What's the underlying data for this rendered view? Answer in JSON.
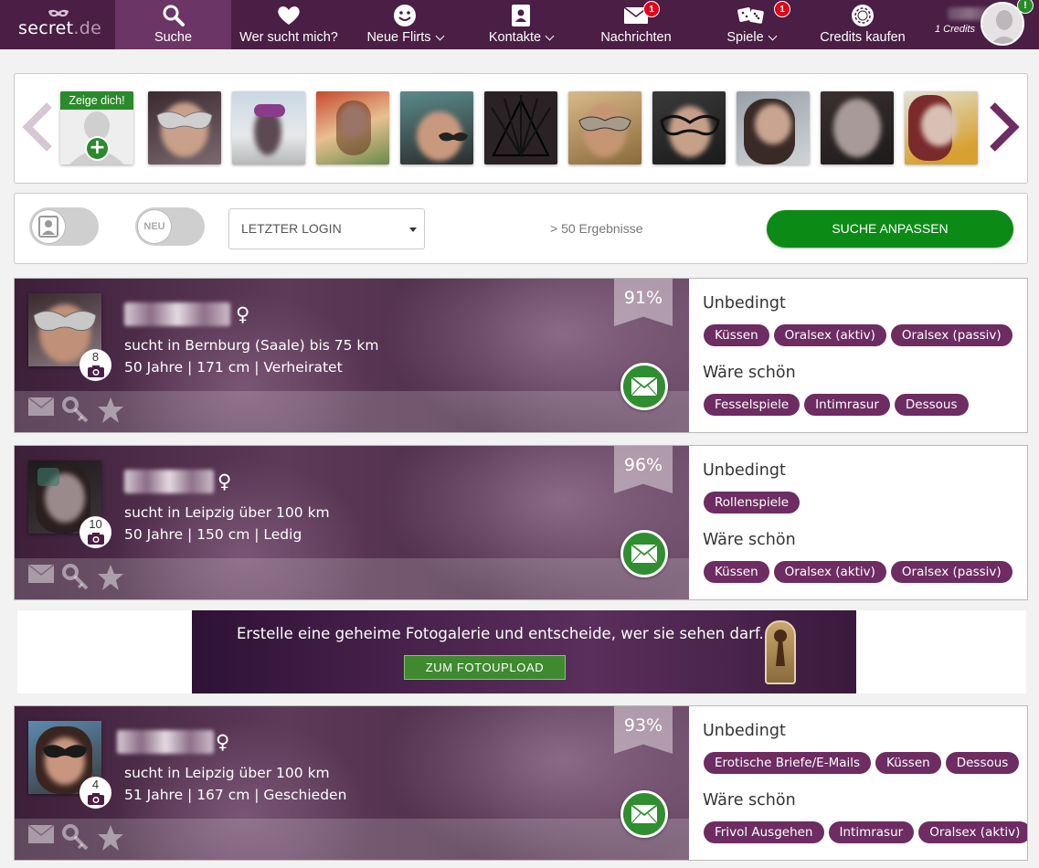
{
  "brand": {
    "name": "secret",
    "tld": ".de"
  },
  "nav": [
    {
      "label": "Suche",
      "icon": "search-icon",
      "active": true,
      "caret": false
    },
    {
      "label": "Wer sucht mich?",
      "icon": "heart-icon",
      "caret": false
    },
    {
      "label": "Neue Flirts",
      "icon": "smiley-icon",
      "caret": true
    },
    {
      "label": "Kontakte",
      "icon": "address-book-icon",
      "caret": true
    },
    {
      "label": "Nachrichten",
      "icon": "envelope-icon",
      "badge": "1",
      "caret": false
    },
    {
      "label": "Spiele",
      "icon": "dice-icon",
      "badge": "1",
      "caret": true
    },
    {
      "label": "Credits kaufen",
      "icon": "chip-icon",
      "caret": false
    }
  ],
  "account": {
    "credits": "1 Credits",
    "badge": "!"
  },
  "strip": {
    "own_label": "Zeige dich!",
    "own_plus": "+"
  },
  "filter": {
    "toggle_new": "NEU",
    "sort_value": "LETZTER LOGIN",
    "results": "> 50 Ergebnisse",
    "button": "SUCHE ANPASSEN"
  },
  "section_labels": {
    "must": "Unbedingt",
    "nice": "Wäre schön"
  },
  "profiles": [
    {
      "photo_count": "8",
      "gender": "♀",
      "match": "91%",
      "line1": "sucht in Bernburg (Saale) bis 75 km",
      "line2": "50 Jahre | 171 cm | Verheiratet",
      "must": [
        "Küssen",
        "Oralsex (aktiv)",
        "Oralsex (passiv)"
      ],
      "nice": [
        "Fesselspiele",
        "Intimrasur",
        "Dessous"
      ]
    },
    {
      "photo_count": "10",
      "gender": "♀",
      "match": "96%",
      "line1": "sucht in Leipzig über 100 km",
      "line2": "50 Jahre | 150 cm | Ledig",
      "must": [
        "Rollenspiele"
      ],
      "nice": [
        "Küssen",
        "Oralsex (aktiv)",
        "Oralsex (passiv)"
      ]
    },
    {
      "photo_count": "4",
      "gender": "♀",
      "match": "93%",
      "line1": "sucht in Leipzig über 100 km",
      "line2": "51 Jahre | 167 cm | Geschieden",
      "must": [
        "Erotische Briefe/E-Mails",
        "Küssen",
        "Dessous"
      ],
      "nice": [
        "Frivol Ausgehen",
        "Intimrasur",
        "Oralsex (aktiv)"
      ]
    }
  ],
  "banner": {
    "text": "Erstelle eine geheime Fotogalerie und entscheide, wer sie sehen darf.",
    "button": "ZUM FOTOUPLOAD"
  },
  "colors": {
    "nav_bg": "#4a1e45",
    "nav_active": "#6b3565",
    "tag": "#6d2c62",
    "green": "#0c8a16",
    "badge_red": "#e2001a"
  }
}
